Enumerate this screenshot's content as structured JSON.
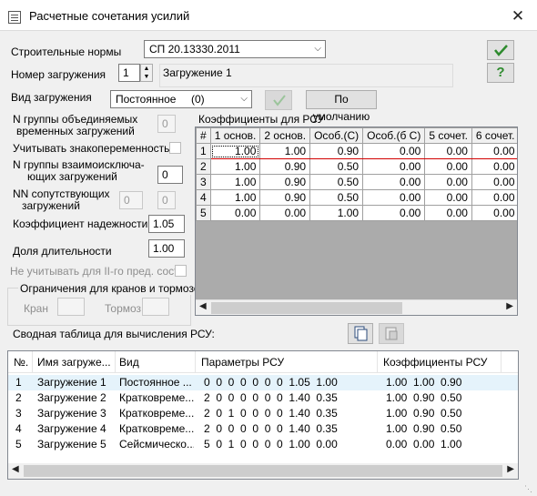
{
  "window": {
    "title": "Расчетные сочетания усилий",
    "close_glyph": "✕"
  },
  "norms": {
    "label": "Строительные нормы",
    "value": "СП 20.13330.2011"
  },
  "load_number": {
    "label": "Номер загружения",
    "value": "1",
    "name": "Загружение  1"
  },
  "load_type": {
    "label": "Вид загружения",
    "value": "Постоянное",
    "code": "(0)",
    "default_button": "По умолчанию"
  },
  "params": {
    "group_combined_label_1": "N группы объединяемых",
    "group_combined_label_2": "временных загружений",
    "group_combined_value": "0",
    "alternating_label": "Учитывать знакопеременность",
    "group_exclusive_label_1": "N группы взаимоисключа-",
    "group_exclusive_label_2": "ющих загружений",
    "group_exclusive_value": "0",
    "accompanying_label_1": "NN сопутствующих",
    "accompanying_label_2": "загружений",
    "accompanying_value_1": "0",
    "accompanying_value_2": "0",
    "reliability_label": "Коэффициент надежности",
    "reliability_value": "1.05",
    "duration_label": "Доля длительности",
    "duration_value": "1.00",
    "ignore_label": "Не учитывать для II-го пред. сост.",
    "crane_group_title": "Ограничения для кранов и тормозов",
    "crane_label": "Кран",
    "brake_label": "Тормоз"
  },
  "coef_table": {
    "title": "Коэффициенты для РСУ",
    "corner": "#",
    "columns": [
      "1 основ.",
      "2 основ.",
      "Особ.(С)",
      "Особ.(б С)",
      "5 сочет.",
      "6 сочет."
    ],
    "rows": [
      {
        "n": "1",
        "values": [
          "1.00",
          "1.00",
          "0.90",
          "0.00",
          "0.00",
          "0.00"
        ]
      },
      {
        "n": "2",
        "values": [
          "1.00",
          "0.90",
          "0.50",
          "0.00",
          "0.00",
          "0.00"
        ]
      },
      {
        "n": "3",
        "values": [
          "1.00",
          "0.90",
          "0.50",
          "0.00",
          "0.00",
          "0.00"
        ]
      },
      {
        "n": "4",
        "values": [
          "1.00",
          "0.90",
          "0.50",
          "0.00",
          "0.00",
          "0.00"
        ]
      },
      {
        "n": "5",
        "values": [
          "0.00",
          "0.00",
          "1.00",
          "0.00",
          "0.00",
          "0.00"
        ]
      }
    ]
  },
  "summary": {
    "title": "Сводная таблица для вычисления РСУ:",
    "columns": [
      "№.",
      "Имя загруже...",
      "Вид",
      "Параметры РСУ",
      "Коэффициенты РСУ"
    ],
    "rows": [
      {
        "n": "1",
        "name": "Загружение  1",
        "type": "Постоянное ...",
        "params": "0  0  0  0  0  0  0  1.05  1.00",
        "coefs": "1.00  1.00  0.90"
      },
      {
        "n": "2",
        "name": "Загружение 2",
        "type": "Кратковреме...",
        "params": "2  0  0  0  0  0  0  1.40  0.35",
        "coefs": "1.00  0.90  0.50"
      },
      {
        "n": "3",
        "name": "Загружение 3",
        "type": "Кратковреме...",
        "params": "2  0  1  0  0  0  0  1.40  0.35",
        "coefs": "1.00  0.90  0.50"
      },
      {
        "n": "4",
        "name": "Загружение 4",
        "type": "Кратковреме...",
        "params": "2  0  0  0  0  0  0  1.40  0.35",
        "coefs": "1.00  0.90  0.50"
      },
      {
        "n": "5",
        "name": "Загружение  5",
        "type": "Сейсмическо...",
        "params": "5  0  1  0  0  0  0  1.00  0.00",
        "coefs": "0.00  0.00  1.00"
      }
    ]
  },
  "icons": {
    "ok": "check-icon",
    "help": "question-icon",
    "apply": "check-icon",
    "copy": "copy-icon",
    "paste": "paste-icon"
  },
  "colors": {
    "accept_green": "#2e8b2e",
    "selected_row_border": "#d20000",
    "selection_bg": "#e5f3fb"
  }
}
